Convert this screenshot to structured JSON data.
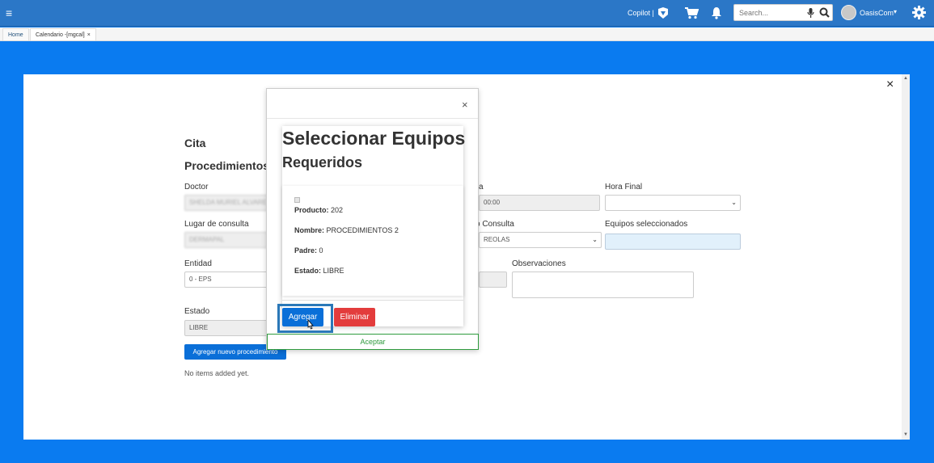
{
  "topbar": {
    "copilot_label": "Copilot |",
    "search_placeholder": "Search...",
    "user_name": "OasisCom",
    "caret": "▾"
  },
  "tabs": [
    {
      "label": "Home"
    },
    {
      "label": "Calendario -[mgcal]",
      "close": "×"
    }
  ],
  "main": {
    "close": "×",
    "cita_title": "Cita",
    "procedimientos_title": "Procedimientos",
    "labels": {
      "doctor": "Doctor",
      "fecha_partial": "a",
      "hora_final": "Hora Final",
      "lugar": "Lugar de consulta",
      "motivo_partial": "tivo Consulta",
      "equipos": "Equipos seleccionados",
      "entidad": "Entidad",
      "observaciones": "Observaciones",
      "estado": "Estado"
    },
    "values": {
      "doctor": "SHELDA MURIEL ALVARE",
      "hora_inicio_partial": "00:00",
      "hora_final": "",
      "lugar": "DERMAPAL",
      "motivo_partial": "REOLAS",
      "equipos": "",
      "entidad": "0 - EPS",
      "estado": "LIBRE"
    },
    "nuevo_button": "Agregar nuevo procedimiento",
    "no_items": "No items added yet."
  },
  "modal": {
    "close": "×",
    "title_line1": "Seleccionar Equipos",
    "title_line2": "Requeridos",
    "item": {
      "producto_label": "Producto:",
      "producto_value": " 202",
      "nombre_label": "Nombre:",
      "nombre_value": " PROCEDIMIENTOS 2",
      "padre_label": "Padre:",
      "padre_value": " 0",
      "estado_label": "Estado:",
      "estado_value": " LIBRE"
    },
    "agregar_button": "Agregar",
    "eliminar_button": "Eliminar",
    "aceptar_button": "Aceptar"
  },
  "colors": {
    "background": "#0a7bf0",
    "topbar": "#2b77c7",
    "primary": "#0a6fd8",
    "danger": "#e33c3c",
    "success": "#2e9a3d"
  }
}
